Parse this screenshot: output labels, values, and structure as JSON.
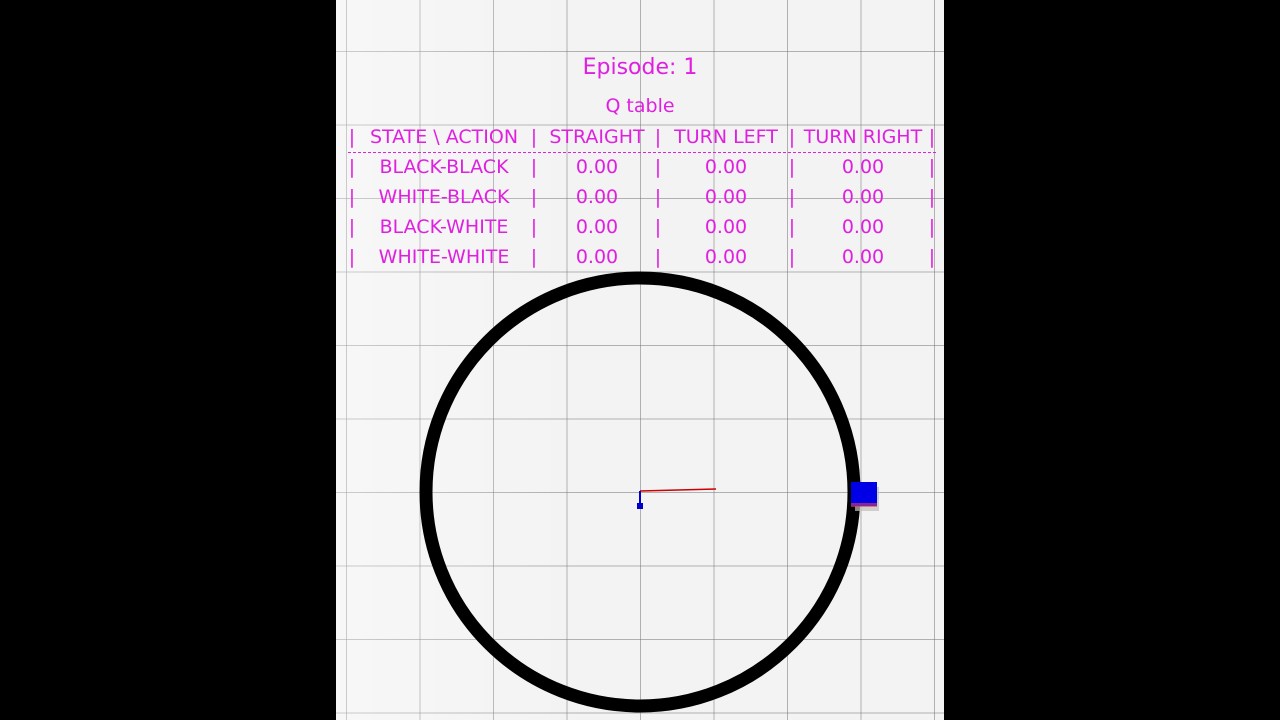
{
  "hud": {
    "episode_label": "Episode: 1",
    "qtable_title": "Q table"
  },
  "qtable": {
    "header": [
      "STATE \\ ACTION",
      "STRAIGHT",
      "TURN LEFT",
      "TURN RIGHT"
    ],
    "rows": [
      {
        "state": "BLACK-BLACK",
        "straight": "0.00",
        "turn_left": "0.00",
        "turn_right": "0.00"
      },
      {
        "state": "WHITE-BLACK",
        "straight": "0.00",
        "turn_left": "0.00",
        "turn_right": "0.00"
      },
      {
        "state": "BLACK-WHITE",
        "straight": "0.00",
        "turn_left": "0.00",
        "turn_right": "0.00"
      },
      {
        "state": "WHITE-WHITE",
        "straight": "0.00",
        "turn_left": "0.00",
        "turn_right": "0.00"
      }
    ]
  },
  "colors": {
    "hud_text": "#e020e0",
    "track": "#000000",
    "robot": "#0000e6",
    "axis_x": "#cc0000",
    "axis_origin": "#0000cc",
    "floor": "#f3f3f3",
    "letterbox": "#000000"
  }
}
